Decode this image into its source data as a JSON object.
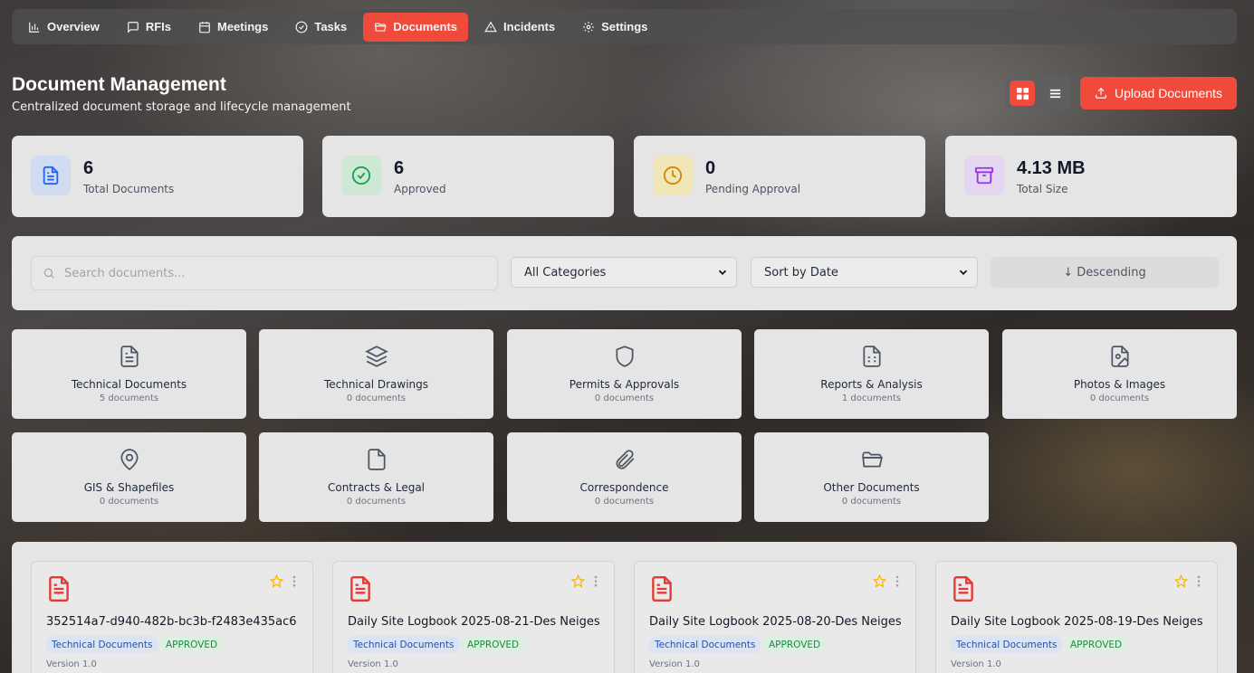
{
  "nav": {
    "items": [
      {
        "label": "Overview",
        "icon": "bar-chart-icon"
      },
      {
        "label": "RFIs",
        "icon": "message-square-icon"
      },
      {
        "label": "Meetings",
        "icon": "calendar-icon"
      },
      {
        "label": "Tasks",
        "icon": "check-circle-icon"
      },
      {
        "label": "Documents",
        "icon": "folder-open-icon",
        "active": true
      },
      {
        "label": "Incidents",
        "icon": "alert-triangle-icon"
      },
      {
        "label": "Settings",
        "icon": "gear-icon"
      }
    ]
  },
  "header": {
    "title": "Document Management",
    "subtitle": "Centralized document storage and lifecycle management",
    "upload_label": "Upload Documents",
    "view_mode": "grid"
  },
  "stats": [
    {
      "value": "6",
      "label": "Total Documents",
      "icon": "file-text-icon",
      "color": "#2563eb",
      "bg": "#d2dcf0"
    },
    {
      "value": "6",
      "label": "Approved",
      "icon": "check-circle-icon",
      "color": "#16a34a",
      "bg": "#cfe8d6"
    },
    {
      "value": "0",
      "label": "Pending Approval",
      "icon": "clock-icon",
      "color": "#ca8a04",
      "bg": "#f1e6b8"
    },
    {
      "value": "4.13 MB",
      "label": "Total Size",
      "icon": "archive-icon",
      "color": "#9333ea",
      "bg": "#e4d6ef"
    }
  ],
  "filters": {
    "search_placeholder": "Search documents...",
    "category_selected": "All Categories",
    "sort_selected": "Sort by Date",
    "sort_direction": "↓  Descending"
  },
  "categories": [
    {
      "name": "Technical Documents",
      "count": "5 documents",
      "icon": "file-text-icon"
    },
    {
      "name": "Technical Drawings",
      "count": "0 documents",
      "icon": "layers-icon"
    },
    {
      "name": "Permits & Approvals",
      "count": "0 documents",
      "icon": "shield-icon"
    },
    {
      "name": "Reports & Analysis",
      "count": "1 documents",
      "icon": "file-spreadsheet-icon"
    },
    {
      "name": "Photos & Images",
      "count": "0 documents",
      "icon": "file-image-icon"
    },
    {
      "name": "GIS & Shapefiles",
      "count": "0 documents",
      "icon": "map-pin-icon"
    },
    {
      "name": "Contracts & Legal",
      "count": "0 documents",
      "icon": "file-icon"
    },
    {
      "name": "Correspondence",
      "count": "0 documents",
      "icon": "paperclip-icon"
    },
    {
      "name": "Other Documents",
      "count": "0 documents",
      "icon": "folder-open-icon"
    }
  ],
  "documents": [
    {
      "title": "352514a7-d940-482b-bc3b-f2483e435ac6",
      "category": "Technical Documents",
      "status": "APPROVED",
      "version": "Version 1.0"
    },
    {
      "title": "Daily Site Logbook 2025-08-21-Des Neiges",
      "category": "Technical Documents",
      "status": "APPROVED",
      "version": "Version 1.0"
    },
    {
      "title": "Daily Site Logbook 2025-08-20-Des Neiges",
      "category": "Technical Documents",
      "status": "APPROVED",
      "version": "Version 1.0"
    },
    {
      "title": "Daily Site Logbook 2025-08-19-Des Neiges",
      "category": "Technical Documents",
      "status": "APPROVED",
      "version": "Version 1.0"
    }
  ],
  "colors": {
    "accent": "#f04a3a",
    "pdf_red": "#e53935",
    "star": "#f5b800"
  }
}
